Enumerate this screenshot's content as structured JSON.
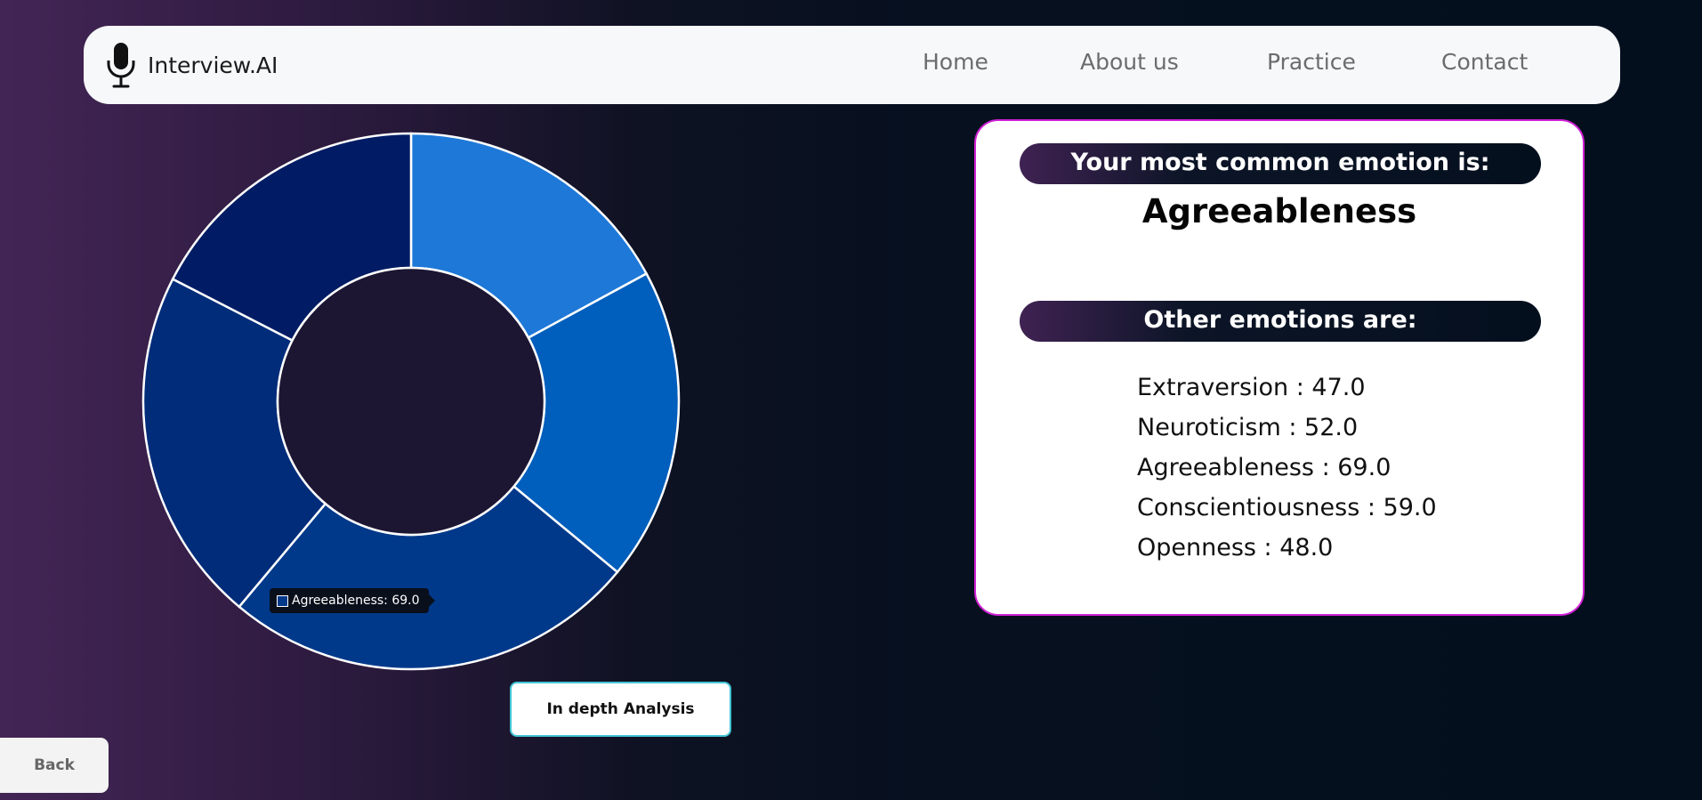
{
  "navbar": {
    "brand": "Interview.AI",
    "brand_icon": "microphone-icon",
    "links": [
      "Home",
      "About us",
      "Practice",
      "Contact"
    ]
  },
  "chart_data": {
    "type": "pie",
    "style": "donut",
    "categories": [
      "Extraversion",
      "Neuroticism",
      "Agreeableness",
      "Conscientiousness",
      "Openness"
    ],
    "values": [
      47.0,
      52.0,
      69.0,
      59.0,
      48.0
    ],
    "colors": [
      "#1e78d8",
      "#005ebc",
      "#00398a",
      "#002c7a",
      "#011c64"
    ],
    "legend": "none",
    "tooltip": {
      "category": "Agreeableness",
      "label": "Agreeableness: 69.0"
    }
  },
  "buttons": {
    "analysis": "In depth Analysis",
    "back": "Back"
  },
  "result": {
    "common_heading": "Your most common emotion is:",
    "common_emotion": "Agreeableness",
    "other_heading": "Other emotions are:",
    "emotions": [
      "Extraversion : 47.0",
      "Neuroticism : 52.0",
      "Agreeableness : 69.0",
      "Conscientiousness : 59.0",
      "Openness : 48.0"
    ]
  },
  "colors": {
    "card_border": "#d021d6",
    "button_border": "#42c4d4",
    "navbar_bg": "#f7f8fa"
  }
}
